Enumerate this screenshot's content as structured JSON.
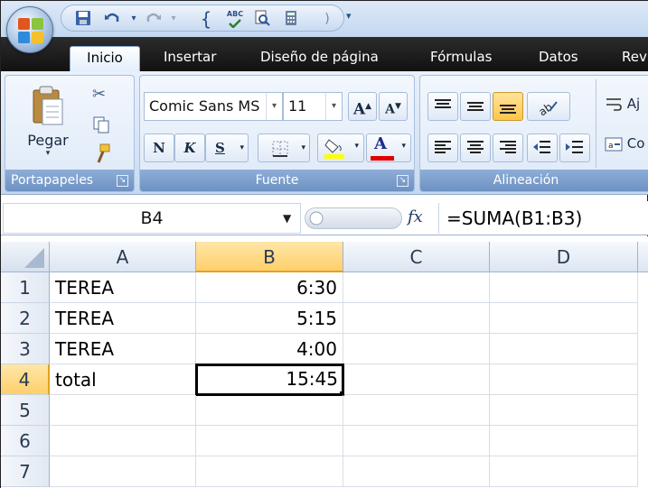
{
  "quick_access": {
    "icons": [
      "save-icon",
      "undo-icon",
      "redo-icon",
      "brace-icon",
      "spelling-icon",
      "print-preview-icon",
      "calculator-icon"
    ],
    "spelling_text": "ABC"
  },
  "tabs": [
    "Inicio",
    "Insertar",
    "Diseño de página",
    "Fórmulas",
    "Datos",
    "Rev"
  ],
  "ribbon": {
    "clipboard": {
      "paste_label": "Pegar",
      "group_label": "Portapapeles"
    },
    "font": {
      "font_name": "Comic Sans MS",
      "font_size": "11",
      "grow_label": "A",
      "shrink_label": "A",
      "bold_label": "N",
      "italic_label": "K",
      "underline_label": "S",
      "font_color_label": "A",
      "group_label": "Fuente"
    },
    "alignment": {
      "group_label": "Alineación",
      "wrap_label": "Aj",
      "merge_label": "Co"
    }
  },
  "formula_bar": {
    "name_box": "B4",
    "fx_label": "fx",
    "formula": "=SUMA(B1:B3)"
  },
  "grid": {
    "columns": [
      "A",
      "B",
      "C",
      "D"
    ],
    "rows": [
      "1",
      "2",
      "3",
      "4",
      "5",
      "6",
      "7"
    ],
    "cells": {
      "A1": "TEREA",
      "B1": "6:30",
      "A2": "TEREA",
      "B2": "5:15",
      "A3": "TEREA",
      "B3": "4:00",
      "A4": "total",
      "B4": "15:45"
    },
    "active_cell": "B4"
  },
  "colors": {
    "selection_header": "#ffcf6b",
    "ribbon_label": "#6d91c2",
    "tab_bar": "#1a1a1a"
  }
}
